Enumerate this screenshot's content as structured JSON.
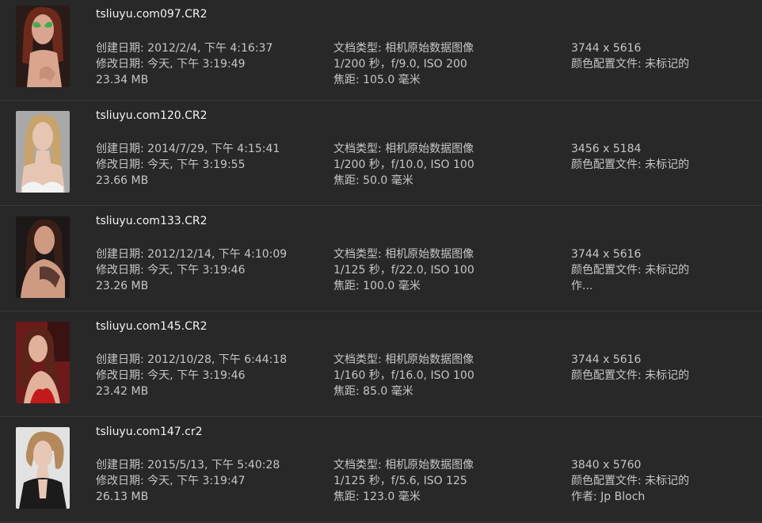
{
  "files": [
    {
      "name": "tsliuyu.com097.CR2",
      "created": "创建日期: 2012/2/4, 下午 4:16:37",
      "modified": "修改日期: 今天, 下午 3:19:49",
      "size": "23.34 MB",
      "kind": "文档类型: 相机原始数据图像",
      "exposure": "1/200 秒，f/9.0, ISO 200",
      "focal": "焦距: 105.0 毫米",
      "dimensions": "3744 x 5616",
      "color_profile": "颜色配置文件: 未标记的",
      "author": ""
    },
    {
      "name": "tsliuyu.com120.CR2",
      "created": "创建日期: 2014/7/29, 下午 4:15:41",
      "modified": "修改日期: 今天, 下午 3:19:55",
      "size": "23.66 MB",
      "kind": "文档类型: 相机原始数据图像",
      "exposure": "1/200 秒，f/10.0, ISO 100",
      "focal": "焦距: 50.0 毫米",
      "dimensions": "3456 x 5184",
      "color_profile": "颜色配置文件: 未标记的",
      "author": ""
    },
    {
      "name": "tsliuyu.com133.CR2",
      "created": "创建日期: 2012/12/14, 下午 4:10:09",
      "modified": "修改日期: 今天, 下午 3:19:46",
      "size": "23.26 MB",
      "kind": "文档类型: 相机原始数据图像",
      "exposure": "1/125 秒，f/22.0, ISO 100",
      "focal": "焦距: 100.0 毫米",
      "dimensions": "3744 x 5616",
      "color_profile": "颜色配置文件: 未标记的",
      "author": "作..."
    },
    {
      "name": "tsliuyu.com145.CR2",
      "created": "创建日期: 2012/10/28, 下午 6:44:18",
      "modified": "修改日期: 今天, 下午 3:19:46",
      "size": "23.42 MB",
      "kind": "文档类型: 相机原始数据图像",
      "exposure": "1/160 秒，f/16.0, ISO 100",
      "focal": "焦距: 85.0 毫米",
      "dimensions": "3744 x 5616",
      "color_profile": "颜色配置文件: 未标记的",
      "author": ""
    },
    {
      "name": "tsliuyu.com147.cr2",
      "created": "创建日期: 2015/5/13, 下午 5:40:28",
      "modified": "修改日期: 今天, 下午 3:19:47",
      "size": "26.13 MB",
      "kind": "文档类型: 相机原始数据图像",
      "exposure": "1/125 秒，f/5.6, ISO 125",
      "focal": "焦距: 123.0 毫米",
      "dimensions": "3840 x 5760",
      "color_profile": "颜色配置文件: 未标记的",
      "author": "作者: Jp Bloch"
    }
  ],
  "thumbnails": [
    {
      "icon": "portrait-photo-thumbnail",
      "bg": "#2a1a18",
      "hair": "#6b2a1a",
      "skin": "#d9a58f",
      "accent": "#3fae4f"
    },
    {
      "icon": "portrait-photo-thumbnail",
      "bg": "#a9a9a9",
      "hair": "#c9a36c",
      "skin": "#e6c6b3",
      "accent": "#f3f3f3"
    },
    {
      "icon": "portrait-photo-thumbnail",
      "bg": "#1d1818",
      "hair": "#3a1f18",
      "skin": "#cf9a82",
      "accent": "#5b3b33"
    },
    {
      "icon": "portrait-photo-thumbnail",
      "bg": "#6d1a1a",
      "hair": "#5a2418",
      "skin": "#e1b19b",
      "accent": "#c21a1a"
    },
    {
      "icon": "portrait-photo-thumbnail",
      "bg": "#e2e2e2",
      "hair": "#b48a5d",
      "skin": "#e7c8b6",
      "accent": "#1b1b1b"
    }
  ]
}
